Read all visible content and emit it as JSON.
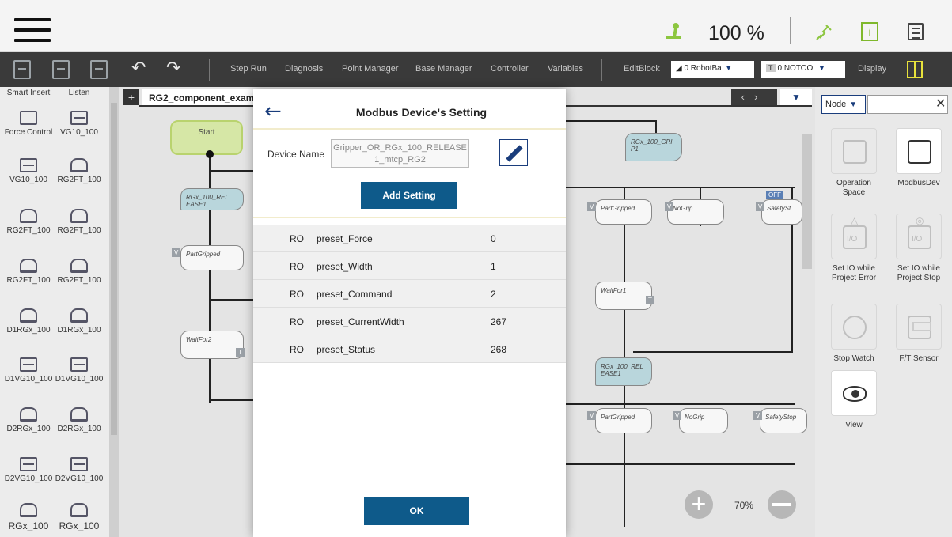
{
  "topbar": {
    "speed": "100 %"
  },
  "toolbar": {
    "items": [
      "Step Run",
      "Diagnosis",
      "Point Manager",
      "Base Manager",
      "Controller",
      "Variables",
      "EditBlock"
    ],
    "robot_base": "0 RobotBa",
    "tool_badge": "T",
    "tool": "0 NOTOOl",
    "display": "Display"
  },
  "palette": {
    "items": [
      "Smart Insert",
      "Listen",
      "Force Control",
      "VG10_100",
      "VG10_100",
      "RG2FT_100",
      "RG2FT_100",
      "RG2FT_100",
      "RG2FT_100",
      "RG2FT_100",
      "D1RGx_100",
      "D1RGx_100",
      "D1VG10_100",
      "D1VG10_100",
      "D2RGx_100",
      "D2RGx_100",
      "D2VG10_100",
      "D2VG10_100",
      "RGx_100",
      "RGx_100"
    ]
  },
  "canvas": {
    "tab": "RG2_component_exam",
    "nodes": {
      "start": "Start",
      "release1": "RGx_100_REL EASE1",
      "partgripped1": "PartGripped",
      "waitfor2": "WaitFor2",
      "grip1": "RGx_100_GRI P1",
      "partgripped2": "PartGripped",
      "nogrip1": "NoGrip",
      "safetystop1": "SafetySt",
      "waitfor1": "WaitFor1",
      "release2": "RGx_100_REL EASE1",
      "partgripped3": "PartGripped",
      "nogrip2": "NoGrip",
      "safetystop2": "SafetyStop"
    },
    "tags": {
      "v": "V",
      "t": "T",
      "off": "OFF"
    },
    "zoom": "70%"
  },
  "right_panel": {
    "filter": "Node",
    "search_value": "",
    "items": [
      "Operation Space",
      "ModbusDev",
      "Set IO while Project Error",
      "Set IO while Project Stop",
      "Stop Watch",
      "F/T Sensor",
      "View"
    ]
  },
  "modal": {
    "title": "Modbus Device's Setting",
    "device_label": "Device Name",
    "device_name_line1": "Gripper_OR_RGx_100_RELEASE",
    "device_name_line2": "1_mtcp_RG2",
    "add_setting": "Add Setting",
    "settings": [
      {
        "mode": "RO",
        "name": "preset_Force",
        "value": "0"
      },
      {
        "mode": "RO",
        "name": "preset_Width",
        "value": "1"
      },
      {
        "mode": "RO",
        "name": "preset_Command",
        "value": "2"
      },
      {
        "mode": "RO",
        "name": "preset_CurrentWidth",
        "value": "267"
      },
      {
        "mode": "RO",
        "name": "preset_Status",
        "value": "268"
      }
    ],
    "ok": "OK"
  }
}
